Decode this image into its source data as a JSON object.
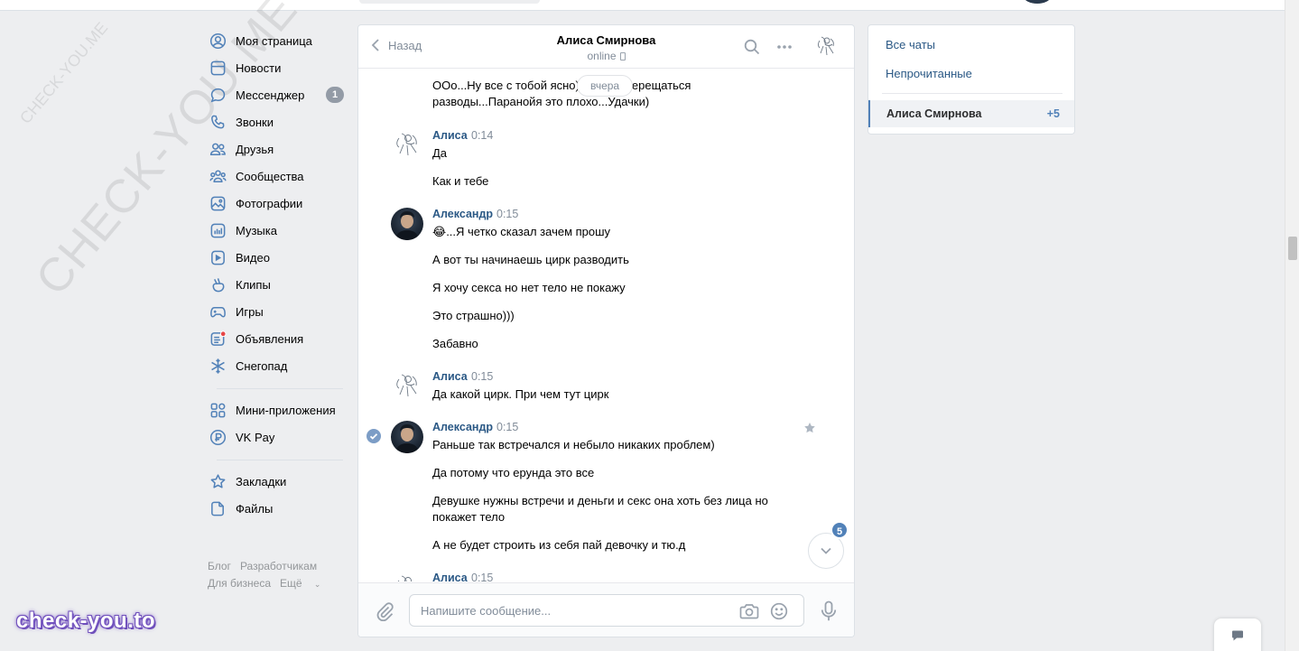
{
  "watermark": {
    "text_small": "CHECK-YOU.ME",
    "text_large": "CHECK-YOU.ME",
    "logo": "check-you.to"
  },
  "nav": {
    "items": [
      {
        "label": "Моя страница",
        "icon": "user-circle-icon"
      },
      {
        "label": "Новости",
        "icon": "news-icon"
      },
      {
        "label": "Мессенджер",
        "icon": "message-icon",
        "badge": "1"
      },
      {
        "label": "Звонки",
        "icon": "phone-icon"
      },
      {
        "label": "Друзья",
        "icon": "friends-icon"
      },
      {
        "label": "Сообщества",
        "icon": "communities-icon"
      },
      {
        "label": "Фотографии",
        "icon": "photo-icon"
      },
      {
        "label": "Музыка",
        "icon": "music-icon"
      },
      {
        "label": "Видео",
        "icon": "video-icon"
      },
      {
        "label": "Клипы",
        "icon": "clips-icon"
      },
      {
        "label": "Игры",
        "icon": "gamepad-icon"
      },
      {
        "label": "Объявления",
        "icon": "ads-icon"
      },
      {
        "label": "Снегопад",
        "icon": "snowflake-icon"
      }
    ],
    "items2": [
      {
        "label": "Мини-приложения",
        "icon": "apps-icon"
      },
      {
        "label": "VK Pay",
        "icon": "vkpay-icon"
      }
    ],
    "items3": [
      {
        "label": "Закладки",
        "icon": "star-icon"
      },
      {
        "label": "Файлы",
        "icon": "file-icon"
      }
    ],
    "footer": {
      "blog": "Блог",
      "dev": "Разработчикам",
      "business": "Для бизнеса",
      "more": "Ещё"
    }
  },
  "chat": {
    "back_label": "Назад",
    "title": "Алиса Смирнова",
    "status": "online",
    "date_pill": "вчера",
    "messages": {
      "m0_l1": "ООо...Ну все с тобой ясно)",
      "m0_l1b": "ерещаться",
      "m0_l2": "разводы...Паранойя это плохо...Удачки)",
      "a1_author": "Алиса",
      "a1_time": "0:14",
      "a1_t1": "Да",
      "a1_t2": "Как и тебе",
      "b1_author": "Александр",
      "b1_time": "0:15",
      "b1_t1": "😂...Я четко сказал зачем прошу",
      "b1_t2": "А вот ты начинаешь цирк разводить",
      "b1_t3": "Я хочу секса но нет тело не покажу",
      "b1_t4": "Это страшно)))",
      "b1_t5": "Забавно",
      "a2_author": "Алиса",
      "a2_time": "0:15",
      "a2_t1": "Да какой цирк. При чем тут цирк",
      "b2_author": "Александр",
      "b2_time": "0:15",
      "b2_t1": "Раньше так встречался и небыло никаких проблем)",
      "b2_t2": "Да потому что ерунда это все",
      "b2_t3": "Девушке нужны встречи и деньги и секс она хоть без лица но",
      "b2_t3b": "покажет тело",
      "b2_t4": "А не будет строить из себя пай девочку и тю.д",
      "a3_author": "Алиса",
      "a3_time": "0:15"
    },
    "unread_count": "5",
    "composer_placeholder": "Напишите сообщение..."
  },
  "right_panel": {
    "all_chats": "Все чаты",
    "unread": "Непрочитанные",
    "active_name": "Алиса Смирнова",
    "active_count": "+5"
  },
  "colors": {
    "link": "#2a5885",
    "accent": "#5181b8",
    "bg": "#edeef0"
  }
}
